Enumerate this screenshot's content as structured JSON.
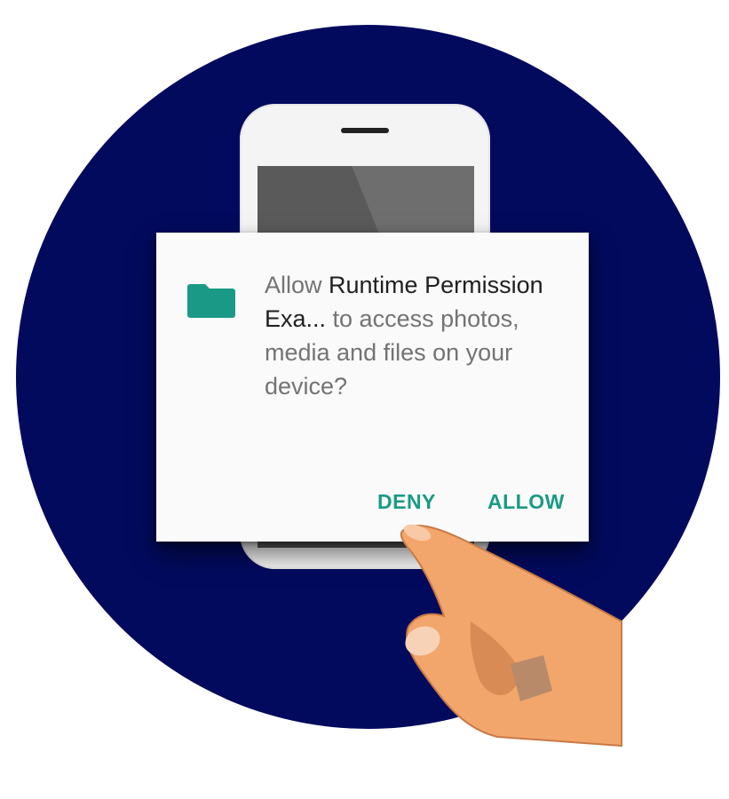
{
  "dialog": {
    "message_prefix": "Allow ",
    "app_name": "Runtime Permission Exa...",
    "message_suffix": " to access photos, media and files on your device?",
    "deny_label": "DENY",
    "allow_label": "ALLOW",
    "icon": "folder-icon"
  },
  "colors": {
    "background_circle": "#020a5e",
    "accent": "#1a9a86",
    "dialog_background": "#fafafa",
    "hand_skin": "#f2a66b"
  }
}
